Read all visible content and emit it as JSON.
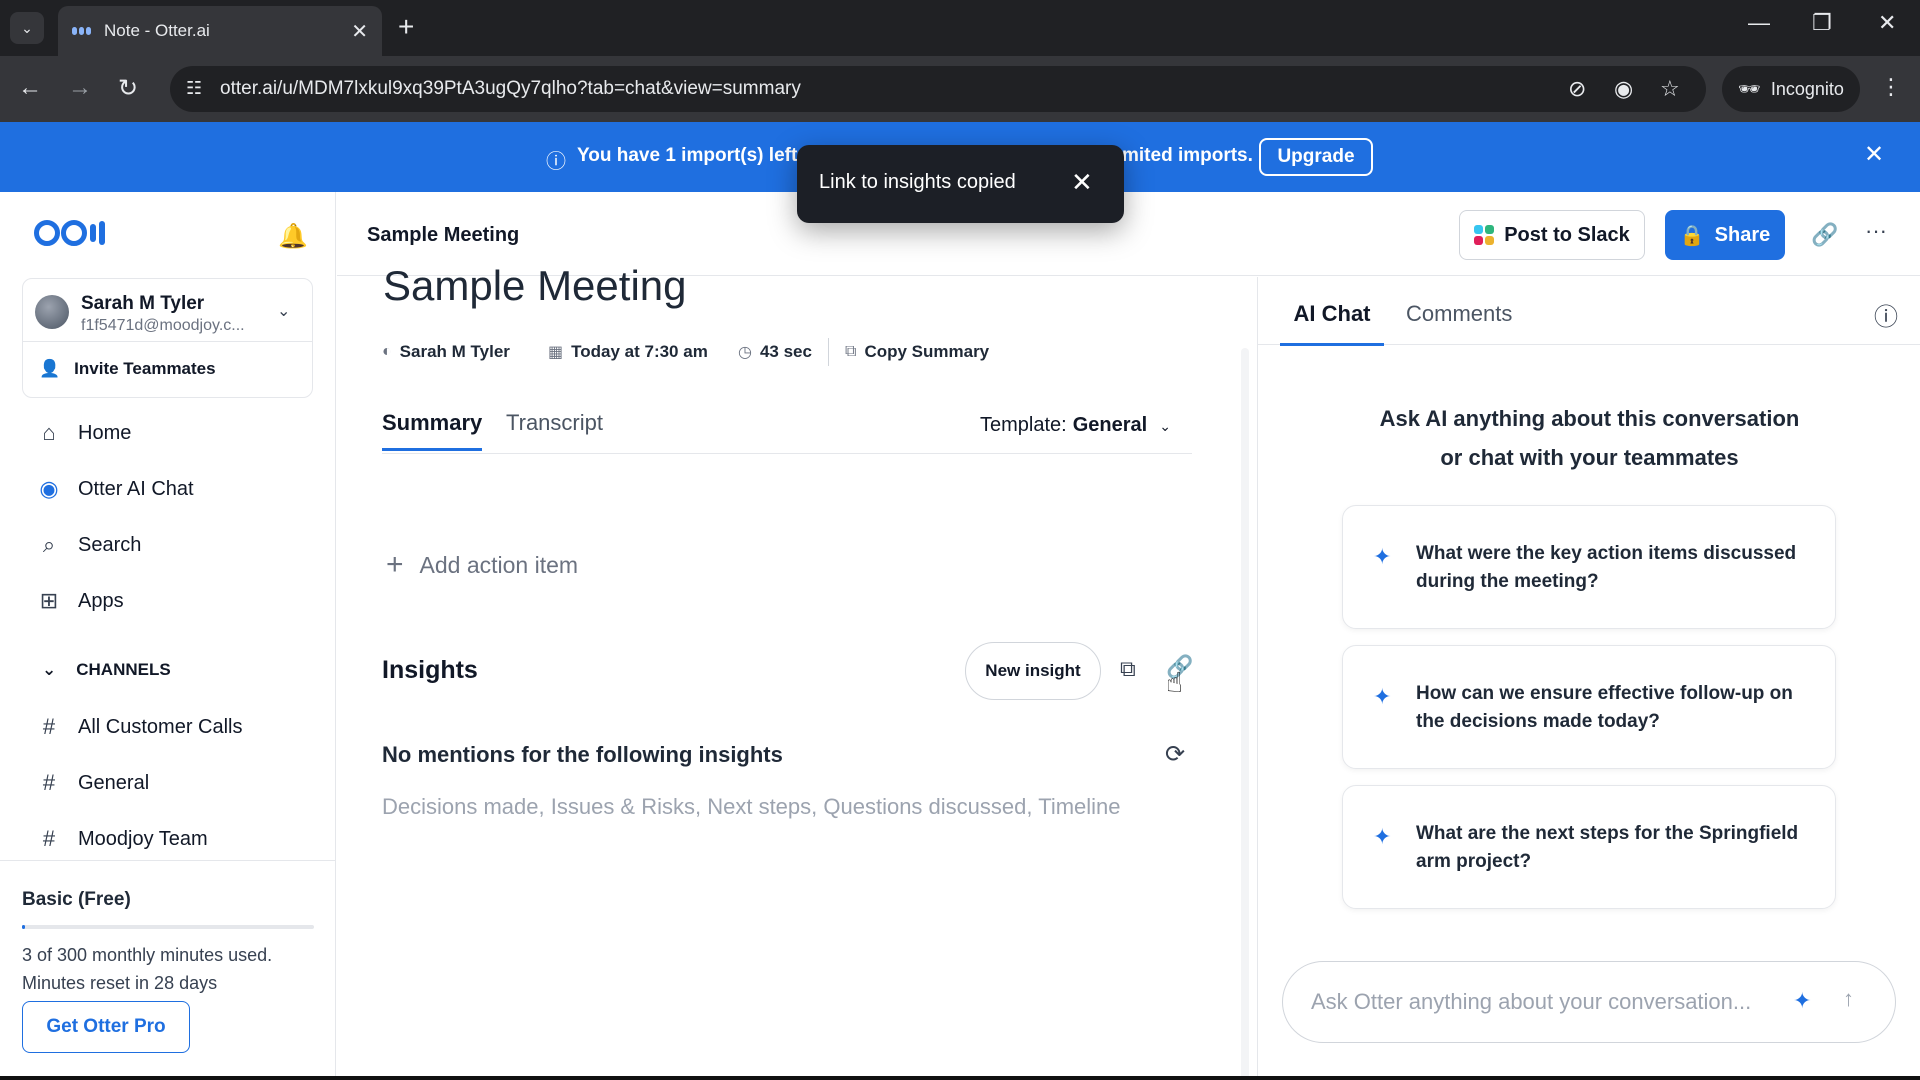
{
  "browser": {
    "tab_title": "Note - Otter.ai",
    "url": "otter.ai/u/MDM7lxkul9xq39PtA3ugQy7qlho?tab=chat&view=summary",
    "incognito_label": "Incognito"
  },
  "banner": {
    "message_start": "You have 1 import(s) left",
    "message_end": "mited imports.",
    "upgrade_label": "Upgrade"
  },
  "toast": {
    "message": "Link to insights copied"
  },
  "sidebar": {
    "user": {
      "name": "Sarah M Tyler",
      "email": "f1f5471d@moodjoy.c..."
    },
    "invite_label": "Invite Teammates",
    "nav": [
      {
        "label": "Home",
        "icon": "home-icon"
      },
      {
        "label": "Otter AI Chat",
        "icon": "otter-chat-icon"
      },
      {
        "label": "Search",
        "icon": "search-icon"
      },
      {
        "label": "Apps",
        "icon": "apps-icon"
      }
    ],
    "channels_header": "CHANNELS",
    "channels": [
      "All Customer Calls",
      "General",
      "Moodjoy Team"
    ],
    "plan": {
      "title": "Basic (Free)",
      "usage_line1": "3 of 300 monthly minutes used.",
      "usage_line2": "Minutes reset in 28 days",
      "usage_fraction": 0.01,
      "cta": "Get Otter Pro"
    }
  },
  "header": {
    "title": "Sample Meeting",
    "slack_label": "Post to Slack",
    "share_label": "Share"
  },
  "note": {
    "title": "Sample Meeting",
    "meta": {
      "author": "Sarah M Tyler",
      "date": "Today at 7:30 am",
      "duration": "43 sec",
      "copy_summary": "Copy Summary"
    },
    "tabs": {
      "summary": "Summary",
      "transcript": "Transcript"
    },
    "template_label": "Template:",
    "template_value": "General",
    "add_action": "Add action item",
    "insights_title": "Insights",
    "new_insight": "New insight",
    "no_mentions": "No mentions for the following insights",
    "insight_list": "Decisions made, Issues & Risks, Next steps, Questions discussed, Timeline"
  },
  "right_panel": {
    "tab_ai": "AI Chat",
    "tab_comments": "Comments",
    "prompt_line1": "Ask AI anything about this conversation",
    "prompt_line2": "or chat with your teammates",
    "suggestions": [
      "What were the key action items discussed during the meeting?",
      "How can we ensure effective follow-up on the decisions made today?",
      "What are the next steps for the Springfield arm project?"
    ],
    "input_placeholder": "Ask Otter anything about your conversation..."
  },
  "colors": {
    "accent": "#1f6fe0",
    "browser_dark": "#202124",
    "browser_toolbar": "#35363a"
  }
}
